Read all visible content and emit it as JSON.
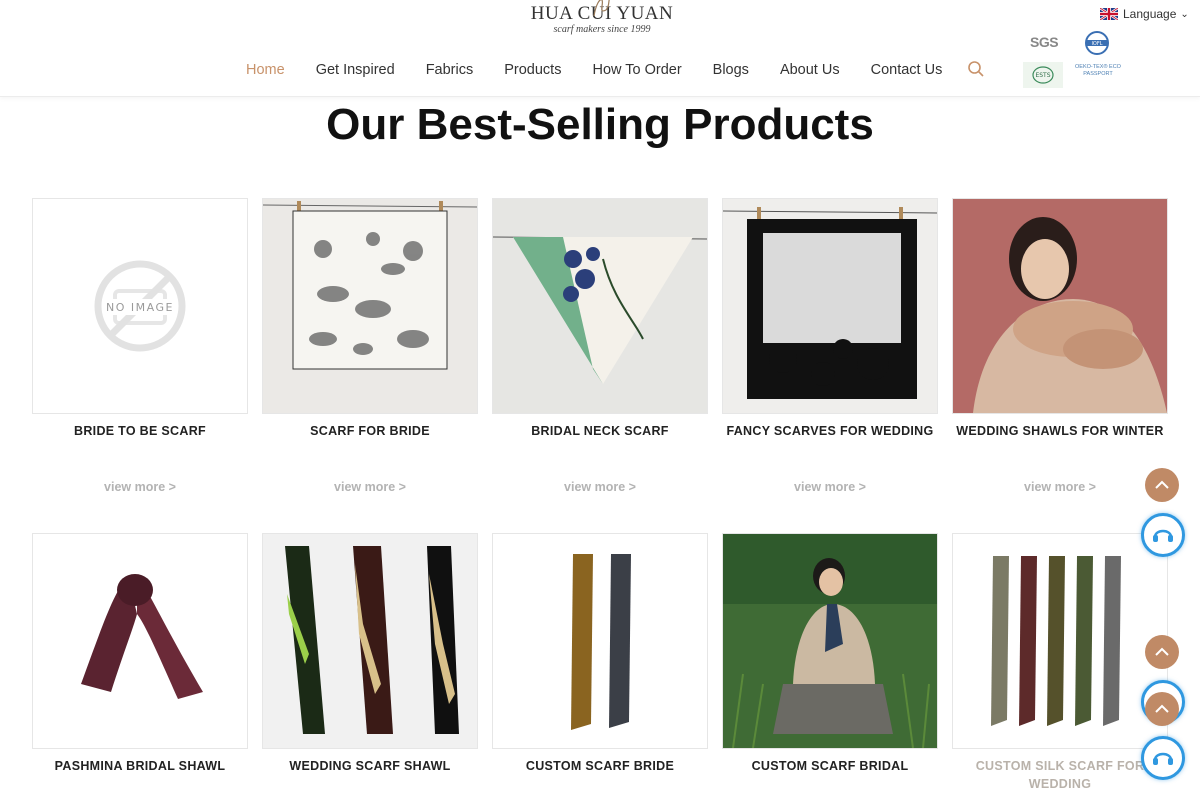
{
  "header": {
    "logo_title": "HUA CUI YUAN",
    "logo_subtitle": "scarf makers since 1999",
    "nav": [
      "Home",
      "Get Inspired",
      "Fabrics",
      "Products",
      "How To Order",
      "Blogs",
      "About Us",
      "Contact Us"
    ],
    "active_nav": "Home",
    "language_label": "Language",
    "certs": {
      "sgs": "SGS",
      "oeko": "OEKO-TEX® ECO PASSPORT"
    },
    "accent_color": "#c8926a"
  },
  "section": {
    "title": "Our Best-Selling Products"
  },
  "products": [
    {
      "name": "BRIDE TO BE SCARF",
      "more": "view more >",
      "placeholder": "NO IMAGE"
    },
    {
      "name": "SCARF FOR BRIDE",
      "more": "view more >"
    },
    {
      "name": "BRIDAL NECK SCARF",
      "more": "view more >"
    },
    {
      "name": "FANCY SCARVES FOR WEDDING",
      "more": "view more >"
    },
    {
      "name": "WEDDING SHAWLS FOR WINTER",
      "more": "view more >"
    },
    {
      "name": "PASHMINA BRIDAL SHAWL"
    },
    {
      "name": "WEDDING SCARF SHAWL"
    },
    {
      "name": "CUSTOM SCARF BRIDE"
    },
    {
      "name": "CUSTOM SCARF BRIDAL"
    },
    {
      "name": "CUSTOM SILK SCARF FOR WEDDING"
    }
  ],
  "widgets": {
    "up_color": "#c08a66",
    "chat_color": "#2f98e0"
  }
}
